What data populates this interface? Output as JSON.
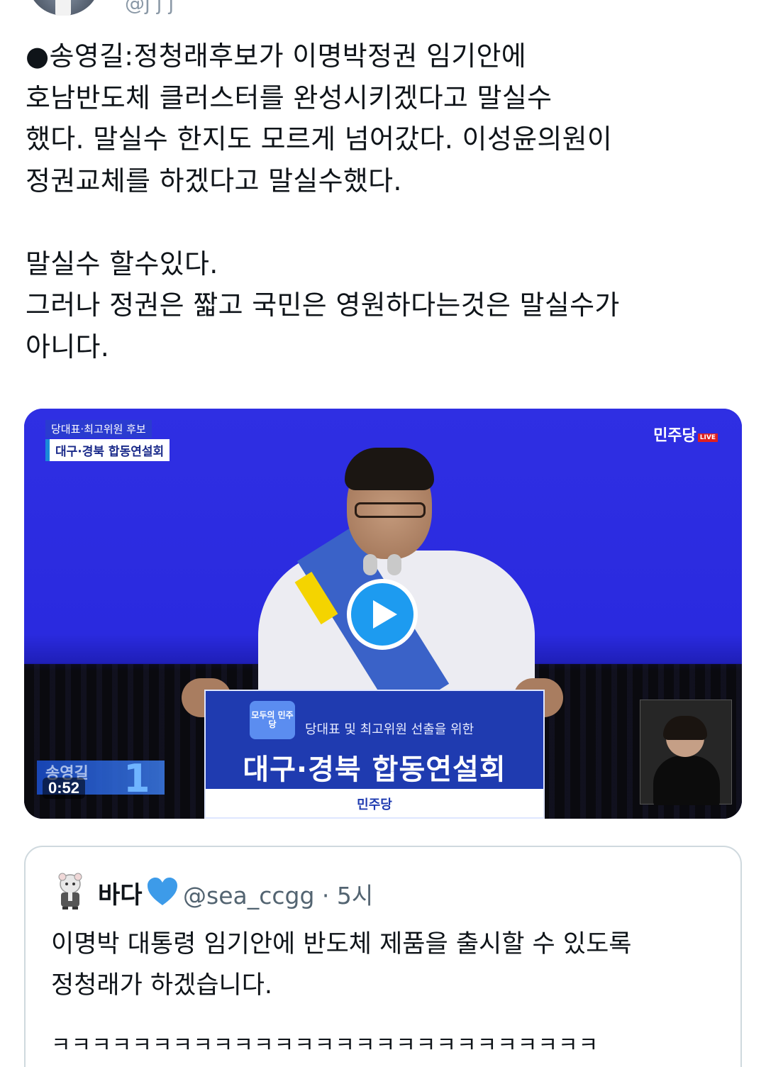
{
  "top": {
    "handle_fragment": "@j   j   j"
  },
  "tweet": {
    "text": "●송영길:정청래후보가 이명박정권 임기안에\n호남반도체 클러스터를 완성시키겠다고 말실수\n했다. 말실수 한지도 모르게 넘어갔다. 이성윤의원이\n정권교체를 하겠다고 말실수했다.\n\n말실수 할수있다.\n그러나 정권은 짧고 국민은 영원하다는것은 말실수가\n아니다."
  },
  "video": {
    "caption_top": "당대표·최고위원 후보",
    "caption_main": "대구·경북 합동연설회",
    "broadcaster_logo": "민주당",
    "live_badge": "LIVE",
    "podium_emblem": "모두의 민주당",
    "podium_subtitle": "당대표 및 최고위원 선출을 위한",
    "podium_title": "대구·경북 합동연설회",
    "podium_logo": "민주당",
    "lower_third_name": "송영길",
    "lower_third_number": "1",
    "duration": "0:52",
    "play_color": "#1d9bf0"
  },
  "quote": {
    "name": "바다",
    "handle": "@sea_ccgg · 5시",
    "text": "이명박 대통령 임기안에 반도체 제품을 출시할 수 있도록\n정청래가 하겠습니다.",
    "laugh": "ㅋㅋㅋㅋㅋㅋㅋㅋㅋㅋㅋㅋㅋㅋㅋㅋㅋㅋㅋㅋㅋㅋㅋㅋㅋㅋㅋ"
  }
}
